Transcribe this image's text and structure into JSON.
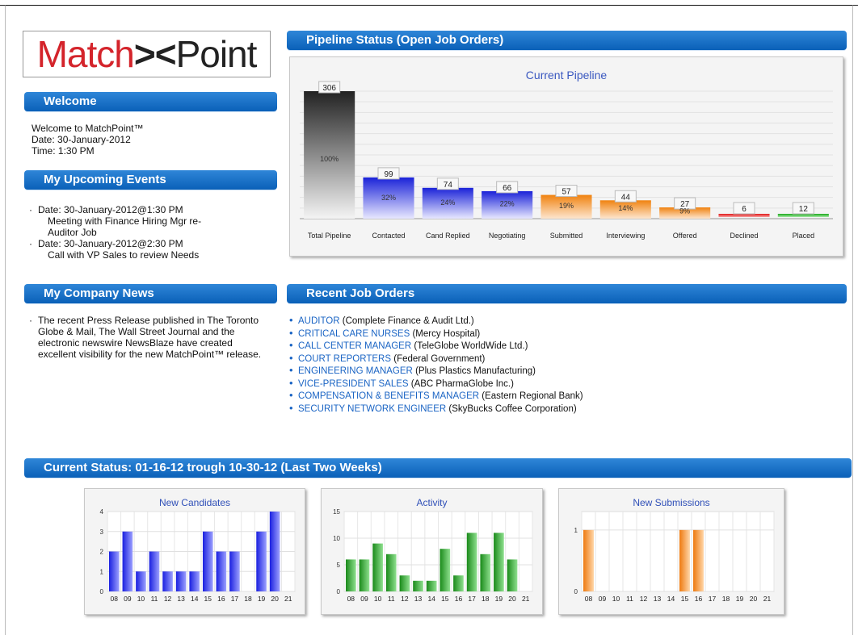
{
  "logo": {
    "part1": "Match",
    "mark": "><",
    "part2": "Point"
  },
  "welcome": {
    "title": "Welcome",
    "line1": "Welcome to MatchPoint™",
    "line2": "Date: 30-January-2012",
    "line3": "Time: 1:30 PM"
  },
  "events": {
    "title": "My Upcoming Events",
    "items": [
      {
        "date": "Date: 30-January-2012@1:30 PM",
        "desc1": "Meeting with Finance Hiring Mgr re-",
        "desc2": "Auditor Job"
      },
      {
        "date": "Date: 30-January-2012@2:30 PM",
        "desc1": "Call with VP Sales to review Needs",
        "desc2": ""
      }
    ]
  },
  "news": {
    "title": "My Company News",
    "text": "The recent Press Release published in The Toronto Globe & Mail, The Wall Street Journal and the electronic newswire NewsBlaze have created excellent visibility for the new MatchPoint™ release."
  },
  "pipeline": {
    "header": "Pipeline Status (Open Job Orders)"
  },
  "jobs": {
    "header": "Recent Job Orders",
    "items": [
      {
        "title": "AUDITOR",
        "company": "(Complete Finance & Audit Ltd.)"
      },
      {
        "title": "CRITICAL CARE NURSES",
        "company": "(Mercy Hospital)"
      },
      {
        "title": "CALL CENTER MANAGER",
        "company": "(TeleGlobe WorldWide Ltd.)"
      },
      {
        "title": "COURT REPORTERS",
        "company": "(Federal Government)"
      },
      {
        "title": "ENGINEERING MANAGER",
        "company": "(Plus Plastics Manufacturing)"
      },
      {
        "title": "VICE-PRESIDENT SALES",
        "company": "(ABC PharmaGlobe Inc.)"
      },
      {
        "title": "COMPENSATION & BENEFITS MANAGER",
        "company": "(Eastern Regional Bank)"
      },
      {
        "title": "SECURITY NETWORK ENGINEER",
        "company": "(SkyBucks Coffee Corporation)"
      }
    ]
  },
  "status": {
    "header": "Current Status: 01-16-12 trough 10-30-12 (Last Two Weeks)"
  },
  "colors": {
    "header_blue": "#0a60b8",
    "link_blue": "#1a64c4",
    "logo_red": "#d4242b"
  },
  "chart_data": [
    {
      "type": "bar",
      "title": "Current Pipeline",
      "categories": [
        "Total Pipeline",
        "Contacted",
        "Cand Replied",
        "Negotiating",
        "Submitted",
        "Interviewing",
        "Offered",
        "Declined",
        "Placed"
      ],
      "values": [
        306,
        99,
        74,
        66,
        57,
        44,
        27,
        6,
        12
      ],
      "percent_labels": [
        "100%",
        "32%",
        "24%",
        "22%",
        "19%",
        "14%",
        "9%",
        "",
        ""
      ],
      "colors": [
        "#444444",
        "#2a34e0",
        "#2a34e0",
        "#2a34e0",
        "#f08a1c",
        "#f08a1c",
        "#f08a1c",
        "#e02020",
        "#22aa22"
      ],
      "ylim": [
        0,
        306
      ],
      "grid": true
    },
    {
      "type": "bar",
      "title": "New Candidates",
      "categories": [
        "08",
        "09",
        "10",
        "11",
        "12",
        "13",
        "14",
        "15",
        "16",
        "17",
        "18",
        "19",
        "20",
        "21"
      ],
      "values": [
        2,
        3,
        1,
        2,
        1,
        1,
        1,
        3,
        2,
        2,
        0,
        3,
        4,
        0
      ],
      "ylim": [
        0,
        4
      ],
      "yticks": [
        0,
        1,
        2,
        3,
        4
      ],
      "color": "#2a34e0",
      "grid": true
    },
    {
      "type": "bar",
      "title": "Activity",
      "categories": [
        "08",
        "09",
        "10",
        "11",
        "12",
        "13",
        "14",
        "15",
        "16",
        "17",
        "18",
        "19",
        "20",
        "21"
      ],
      "values": [
        6,
        6,
        9,
        7,
        3,
        2,
        2,
        8,
        3,
        11,
        7,
        11,
        6,
        0
      ],
      "ylim": [
        0,
        15
      ],
      "yticks": [
        0,
        5,
        10,
        15
      ],
      "color": "#2a9a2a",
      "grid": true
    },
    {
      "type": "bar",
      "title": "New Submissions",
      "categories": [
        "08",
        "09",
        "10",
        "11",
        "12",
        "13",
        "14",
        "15",
        "16",
        "17",
        "18",
        "19",
        "20",
        "21"
      ],
      "values": [
        1,
        0,
        0,
        0,
        0,
        0,
        0,
        1,
        1,
        0,
        0,
        0,
        0,
        0
      ],
      "ylim": [
        0,
        1.3
      ],
      "yticks": [
        0,
        1
      ],
      "color": "#f08a1c",
      "grid": true
    }
  ]
}
